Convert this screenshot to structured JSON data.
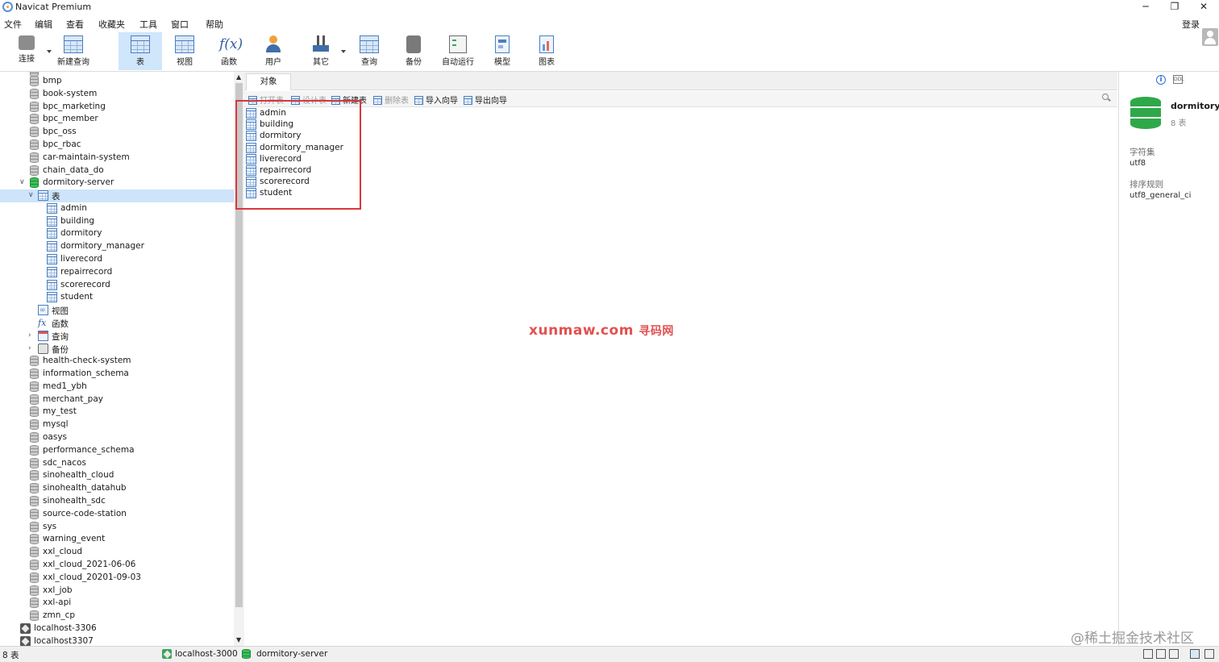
{
  "window": {
    "title": "Navicat Premium",
    "controls": {
      "minimize": "─",
      "restore": "❐",
      "close": "✕"
    }
  },
  "menu": {
    "items": [
      "文件",
      "编辑",
      "查看",
      "收藏夹",
      "工具",
      "窗口",
      "帮助"
    ],
    "login": "登录"
  },
  "toolbar": {
    "buttons": [
      {
        "label": "连接",
        "icon": "connection-icon"
      },
      {
        "label": "新建查询",
        "icon": "new-query-icon"
      },
      {
        "label": "表",
        "icon": "table-icon",
        "active": true
      },
      {
        "label": "视图",
        "icon": "view-icon"
      },
      {
        "label": "函数",
        "icon": "function-icon"
      },
      {
        "label": "用户",
        "icon": "user-icon"
      },
      {
        "label": "其它",
        "icon": "other-tools-icon"
      },
      {
        "label": "查询",
        "icon": "query-icon"
      },
      {
        "label": "备份",
        "icon": "backup-icon"
      },
      {
        "label": "自动运行",
        "icon": "automation-icon"
      },
      {
        "label": "模型",
        "icon": "model-icon"
      },
      {
        "label": "图表",
        "icon": "chart-icon"
      }
    ]
  },
  "tree": {
    "databases_before": [
      "bmp",
      "book-system",
      "bpc_marketing",
      "bpc_member",
      "bpc_oss",
      "bpc_rbac",
      "car-maintain-system",
      "chain_data_do"
    ],
    "open_database": "dormitory-server",
    "tables_node": "表",
    "tables": [
      "admin",
      "building",
      "dormitory",
      "dormitory_manager",
      "liverecord",
      "repairrecord",
      "scorerecord",
      "student"
    ],
    "views_node": "视图",
    "functions_node": "函数",
    "queries_node": "查询",
    "backups_node": "备份",
    "databases_after": [
      "health-check-system",
      "information_schema",
      "med1_ybh",
      "merchant_pay",
      "my_test",
      "mysql",
      "oasys",
      "performance_schema",
      "sdc_nacos",
      "sinohealth_cloud",
      "sinohealth_datahub",
      "sinohealth_sdc",
      "source-code-station",
      "sys",
      "warning_event",
      "xxl_cloud",
      "xxl_cloud_2021-06-06",
      "xxl_cloud_20201-09-03",
      "xxl_job",
      "xxl-api",
      "zmn_cp"
    ],
    "connections": [
      "localhost-3306",
      "localhost3307"
    ]
  },
  "main": {
    "tab": "对象",
    "object_toolbar": [
      {
        "label": "打开表",
        "enabled": false
      },
      {
        "label": "设计表",
        "enabled": false
      },
      {
        "label": "新建表",
        "enabled": true
      },
      {
        "label": "删除表",
        "enabled": false
      },
      {
        "label": "导入向导",
        "enabled": true
      },
      {
        "label": "导出向导",
        "enabled": true
      }
    ],
    "objects": [
      "admin",
      "building",
      "dormitory",
      "dormitory_manager",
      "liverecord",
      "repairrecord",
      "scorerecord",
      "student"
    ],
    "highlight_color": "#d9363e"
  },
  "watermark": {
    "text": "xunmaw.com",
    "suffix": "寻码网",
    "color": "#e2504f"
  },
  "info_panel": {
    "db_name": "dormitory-",
    "table_count": "8 表",
    "charset_label": "字符集",
    "charset_value": "utf8",
    "collation_label": "排序规则",
    "collation_value": "utf8_general_ci"
  },
  "status": {
    "count": "8 表",
    "connection": "localhost-3000",
    "database": "dormitory-server"
  },
  "corner_watermark": "@稀土掘金技术社区",
  "colors": {
    "accent": "#cfe6fb",
    "selection": "#cde4fa",
    "db_open": "#2fa84a"
  }
}
